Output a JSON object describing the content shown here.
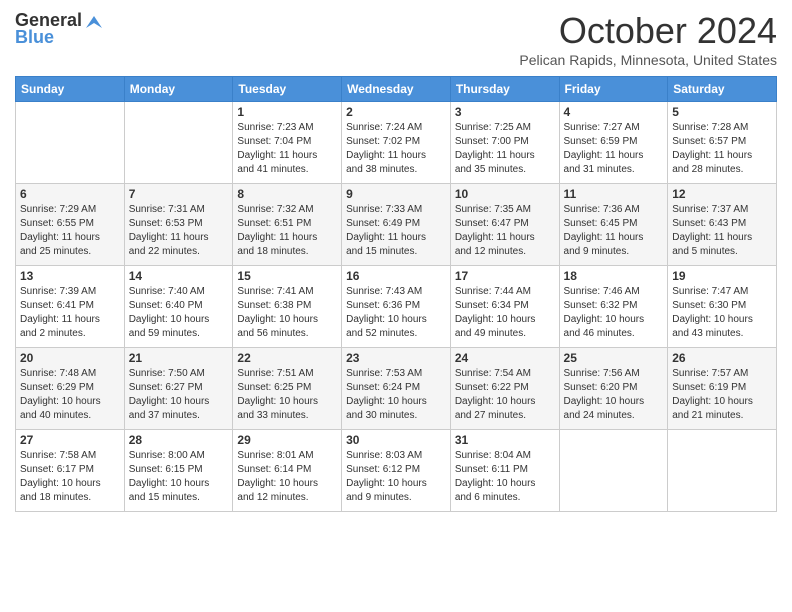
{
  "header": {
    "logo_line1": "General",
    "logo_line2": "Blue",
    "month_title": "October 2024",
    "location": "Pelican Rapids, Minnesota, United States"
  },
  "days_of_week": [
    "Sunday",
    "Monday",
    "Tuesday",
    "Wednesday",
    "Thursday",
    "Friday",
    "Saturday"
  ],
  "weeks": [
    [
      {
        "day": "",
        "info": ""
      },
      {
        "day": "",
        "info": ""
      },
      {
        "day": "1",
        "info": "Sunrise: 7:23 AM\nSunset: 7:04 PM\nDaylight: 11 hours\nand 41 minutes."
      },
      {
        "day": "2",
        "info": "Sunrise: 7:24 AM\nSunset: 7:02 PM\nDaylight: 11 hours\nand 38 minutes."
      },
      {
        "day": "3",
        "info": "Sunrise: 7:25 AM\nSunset: 7:00 PM\nDaylight: 11 hours\nand 35 minutes."
      },
      {
        "day": "4",
        "info": "Sunrise: 7:27 AM\nSunset: 6:59 PM\nDaylight: 11 hours\nand 31 minutes."
      },
      {
        "day": "5",
        "info": "Sunrise: 7:28 AM\nSunset: 6:57 PM\nDaylight: 11 hours\nand 28 minutes."
      }
    ],
    [
      {
        "day": "6",
        "info": "Sunrise: 7:29 AM\nSunset: 6:55 PM\nDaylight: 11 hours\nand 25 minutes."
      },
      {
        "day": "7",
        "info": "Sunrise: 7:31 AM\nSunset: 6:53 PM\nDaylight: 11 hours\nand 22 minutes."
      },
      {
        "day": "8",
        "info": "Sunrise: 7:32 AM\nSunset: 6:51 PM\nDaylight: 11 hours\nand 18 minutes."
      },
      {
        "day": "9",
        "info": "Sunrise: 7:33 AM\nSunset: 6:49 PM\nDaylight: 11 hours\nand 15 minutes."
      },
      {
        "day": "10",
        "info": "Sunrise: 7:35 AM\nSunset: 6:47 PM\nDaylight: 11 hours\nand 12 minutes."
      },
      {
        "day": "11",
        "info": "Sunrise: 7:36 AM\nSunset: 6:45 PM\nDaylight: 11 hours\nand 9 minutes."
      },
      {
        "day": "12",
        "info": "Sunrise: 7:37 AM\nSunset: 6:43 PM\nDaylight: 11 hours\nand 5 minutes."
      }
    ],
    [
      {
        "day": "13",
        "info": "Sunrise: 7:39 AM\nSunset: 6:41 PM\nDaylight: 11 hours\nand 2 minutes."
      },
      {
        "day": "14",
        "info": "Sunrise: 7:40 AM\nSunset: 6:40 PM\nDaylight: 10 hours\nand 59 minutes."
      },
      {
        "day": "15",
        "info": "Sunrise: 7:41 AM\nSunset: 6:38 PM\nDaylight: 10 hours\nand 56 minutes."
      },
      {
        "day": "16",
        "info": "Sunrise: 7:43 AM\nSunset: 6:36 PM\nDaylight: 10 hours\nand 52 minutes."
      },
      {
        "day": "17",
        "info": "Sunrise: 7:44 AM\nSunset: 6:34 PM\nDaylight: 10 hours\nand 49 minutes."
      },
      {
        "day": "18",
        "info": "Sunrise: 7:46 AM\nSunset: 6:32 PM\nDaylight: 10 hours\nand 46 minutes."
      },
      {
        "day": "19",
        "info": "Sunrise: 7:47 AM\nSunset: 6:30 PM\nDaylight: 10 hours\nand 43 minutes."
      }
    ],
    [
      {
        "day": "20",
        "info": "Sunrise: 7:48 AM\nSunset: 6:29 PM\nDaylight: 10 hours\nand 40 minutes."
      },
      {
        "day": "21",
        "info": "Sunrise: 7:50 AM\nSunset: 6:27 PM\nDaylight: 10 hours\nand 37 minutes."
      },
      {
        "day": "22",
        "info": "Sunrise: 7:51 AM\nSunset: 6:25 PM\nDaylight: 10 hours\nand 33 minutes."
      },
      {
        "day": "23",
        "info": "Sunrise: 7:53 AM\nSunset: 6:24 PM\nDaylight: 10 hours\nand 30 minutes."
      },
      {
        "day": "24",
        "info": "Sunrise: 7:54 AM\nSunset: 6:22 PM\nDaylight: 10 hours\nand 27 minutes."
      },
      {
        "day": "25",
        "info": "Sunrise: 7:56 AM\nSunset: 6:20 PM\nDaylight: 10 hours\nand 24 minutes."
      },
      {
        "day": "26",
        "info": "Sunrise: 7:57 AM\nSunset: 6:19 PM\nDaylight: 10 hours\nand 21 minutes."
      }
    ],
    [
      {
        "day": "27",
        "info": "Sunrise: 7:58 AM\nSunset: 6:17 PM\nDaylight: 10 hours\nand 18 minutes."
      },
      {
        "day": "28",
        "info": "Sunrise: 8:00 AM\nSunset: 6:15 PM\nDaylight: 10 hours\nand 15 minutes."
      },
      {
        "day": "29",
        "info": "Sunrise: 8:01 AM\nSunset: 6:14 PM\nDaylight: 10 hours\nand 12 minutes."
      },
      {
        "day": "30",
        "info": "Sunrise: 8:03 AM\nSunset: 6:12 PM\nDaylight: 10 hours\nand 9 minutes."
      },
      {
        "day": "31",
        "info": "Sunrise: 8:04 AM\nSunset: 6:11 PM\nDaylight: 10 hours\nand 6 minutes."
      },
      {
        "day": "",
        "info": ""
      },
      {
        "day": "",
        "info": ""
      }
    ]
  ]
}
